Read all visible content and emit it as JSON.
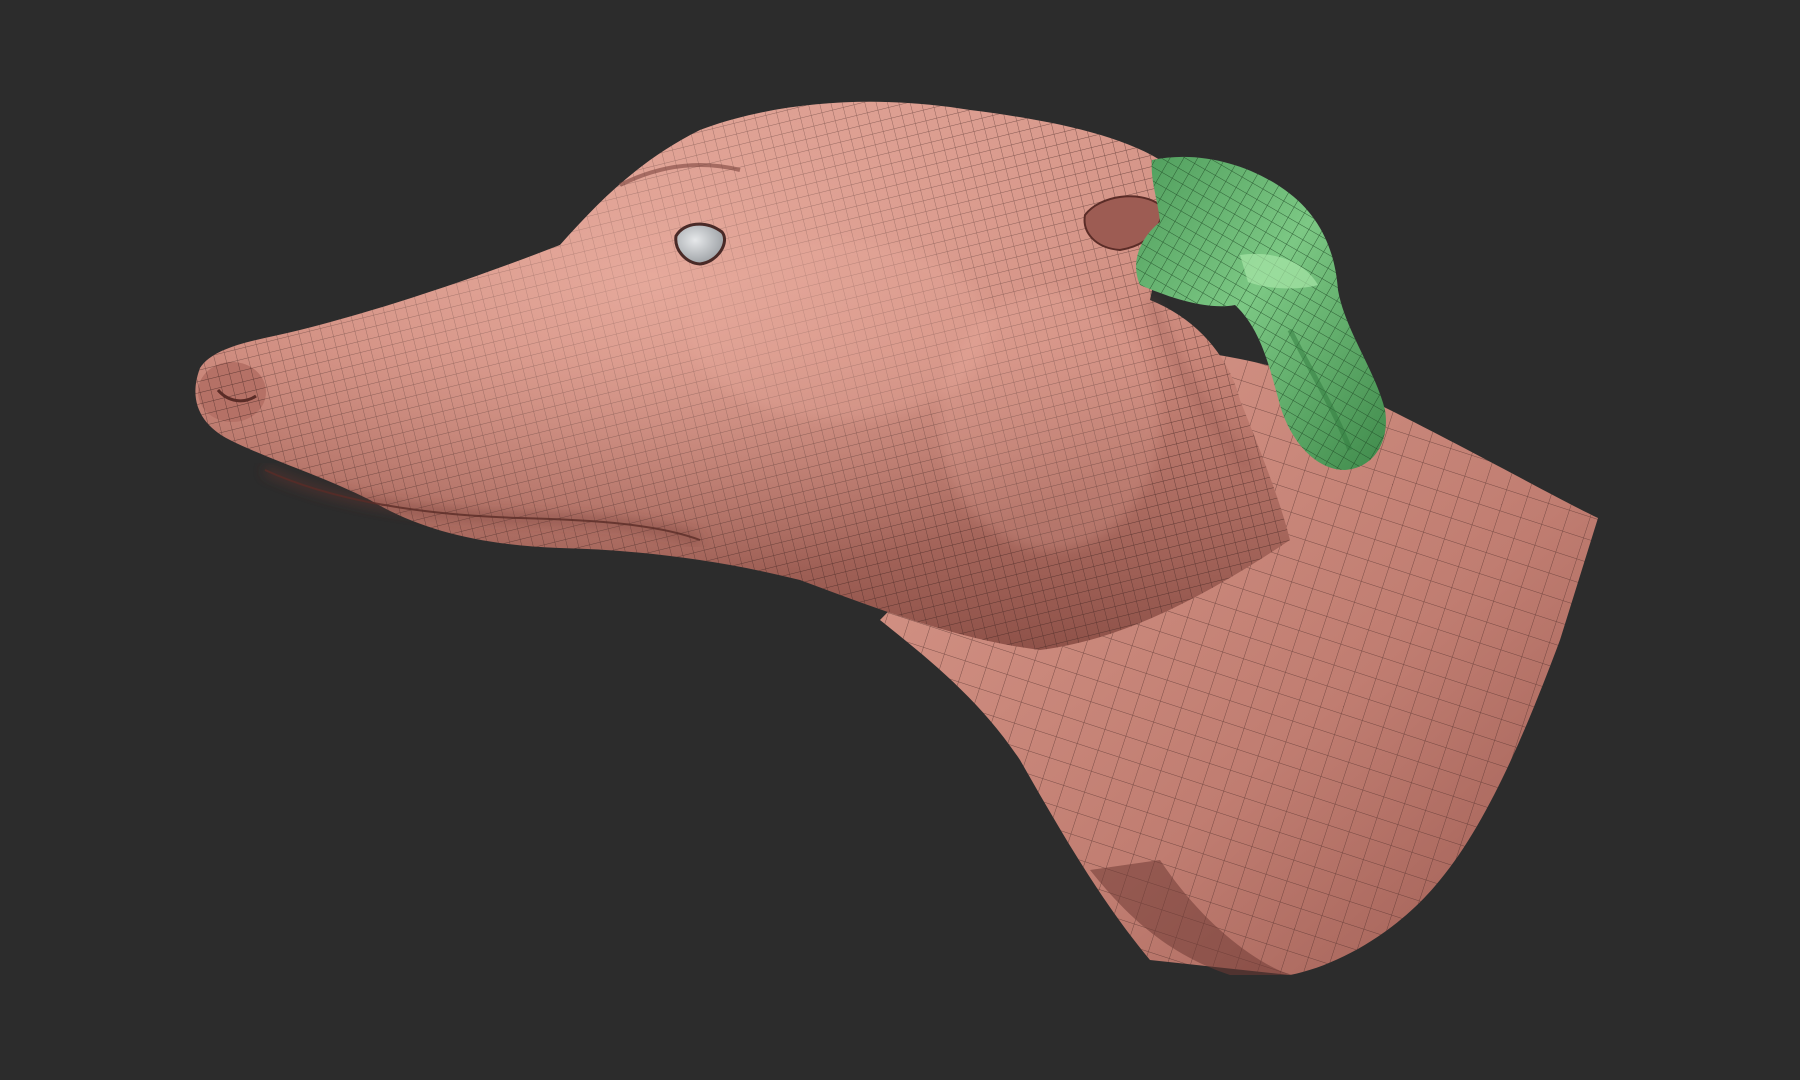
{
  "scene": {
    "subject": "greyhound-head-sculpt",
    "colors": {
      "background": "#2c2c2c",
      "skin": "#c88477",
      "skin_light": "#e0a396",
      "skin_shadow": "#8a4f48",
      "wire": "#4a2a27",
      "mask_green": "#63b06f",
      "mask_green_light": "#8fd392",
      "mask_green_shadow": "#2f7a3d",
      "eye": "#c9cccf"
    },
    "icons": {
      "mesh": "polygon-mesh-icon",
      "masked_region": "mask-region-icon"
    }
  }
}
